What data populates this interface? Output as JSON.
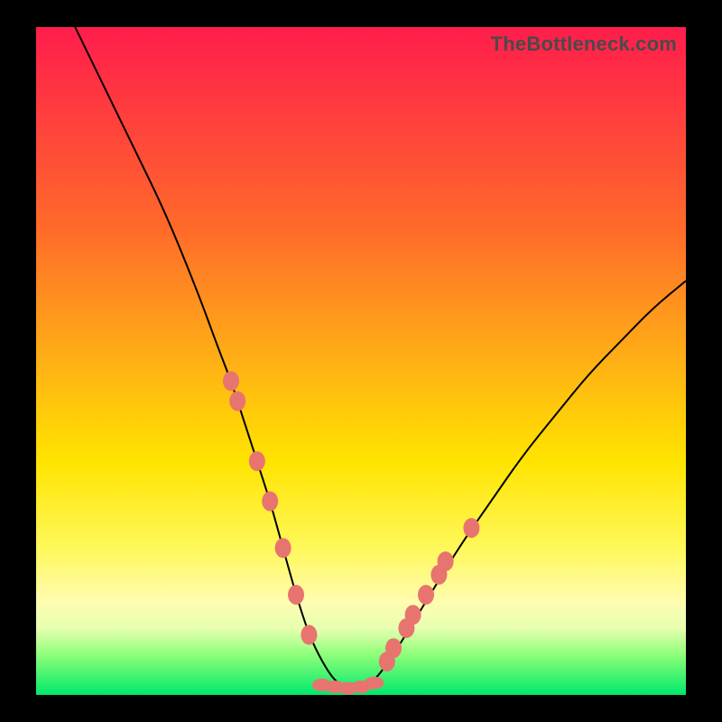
{
  "watermark": "TheBottleneck.com",
  "chart_data": {
    "type": "line",
    "title": "",
    "xlabel": "",
    "ylabel": "",
    "xlim": [
      0,
      100
    ],
    "ylim": [
      0,
      100
    ],
    "curve": {
      "x": [
        6,
        10,
        15,
        20,
        25,
        28,
        30,
        32,
        34,
        36,
        38,
        40,
        42,
        44,
        46,
        48,
        50,
        52,
        55,
        60,
        65,
        70,
        75,
        80,
        85,
        90,
        95,
        100
      ],
      "y": [
        100,
        92,
        82,
        72,
        60,
        52,
        47,
        41,
        35,
        29,
        22,
        15,
        9,
        5,
        2,
        1,
        1,
        2,
        6,
        14,
        22,
        29,
        36,
        42,
        48,
        53,
        58,
        62
      ]
    },
    "left_cluster_points": [
      {
        "x": 30,
        "y": 47
      },
      {
        "x": 31,
        "y": 44
      },
      {
        "x": 34,
        "y": 35
      },
      {
        "x": 36,
        "y": 29
      },
      {
        "x": 38,
        "y": 22
      },
      {
        "x": 40,
        "y": 15
      },
      {
        "x": 42,
        "y": 9
      }
    ],
    "right_cluster_points": [
      {
        "x": 54,
        "y": 5
      },
      {
        "x": 55,
        "y": 7
      },
      {
        "x": 57,
        "y": 10
      },
      {
        "x": 58,
        "y": 12
      },
      {
        "x": 60,
        "y": 15
      },
      {
        "x": 62,
        "y": 18
      },
      {
        "x": 63,
        "y": 20
      },
      {
        "x": 67,
        "y": 25
      }
    ],
    "bottom_flat_points": [
      {
        "x": 44,
        "y": 1.5
      },
      {
        "x": 46,
        "y": 1.2
      },
      {
        "x": 48,
        "y": 1.0
      },
      {
        "x": 50,
        "y": 1.2
      },
      {
        "x": 52,
        "y": 1.8
      }
    ]
  }
}
